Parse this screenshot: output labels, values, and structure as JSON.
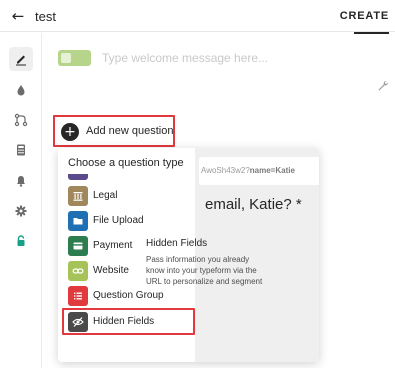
{
  "topbar": {
    "back_icon": "arrow-left-icon",
    "title": "test",
    "create_label": "CREATE"
  },
  "sidebar": {
    "items": [
      {
        "name": "pen-icon",
        "active": true
      },
      {
        "name": "droplet-icon",
        "active": false
      },
      {
        "name": "logic-branch-icon",
        "active": false
      },
      {
        "name": "calculator-icon",
        "active": false
      },
      {
        "name": "bell-icon",
        "active": false
      },
      {
        "name": "gear-icon",
        "active": false
      },
      {
        "name": "lock-icon",
        "active": false,
        "color": "#16a085"
      }
    ]
  },
  "welcome": {
    "toggle_color": "#b7d48b",
    "placeholder": "Type welcome message here...",
    "settings_icon": "wrench-icon"
  },
  "add_question": {
    "label": "Add new question",
    "icon": "plus-icon"
  },
  "question_types": {
    "heading": "Choose a question type",
    "items": [
      {
        "label": "Legal",
        "icon": "legal-icon",
        "color": "#a0875c"
      },
      {
        "label": "File Upload",
        "icon": "folder-icon",
        "color": "#1f6fb2"
      },
      {
        "label": "Payment",
        "icon": "credit-card-icon",
        "color": "#2e7d4f"
      },
      {
        "label": "Website",
        "icon": "link-icon",
        "color": "#a6c35a"
      },
      {
        "label": "Question Group",
        "icon": "list-icon",
        "color": "#e0393e"
      },
      {
        "label": "Hidden Fields",
        "icon": "eye-slash-icon",
        "color": "#4a4a4a"
      }
    ]
  },
  "preview": {
    "url_fragment": "AwoSh43w2?",
    "url_param": "name=Katie",
    "big_text": "email, Katie? *",
    "title": "Hidden Fields",
    "description": "Pass information you already know into your typeform via the URL to personalize and segment"
  }
}
